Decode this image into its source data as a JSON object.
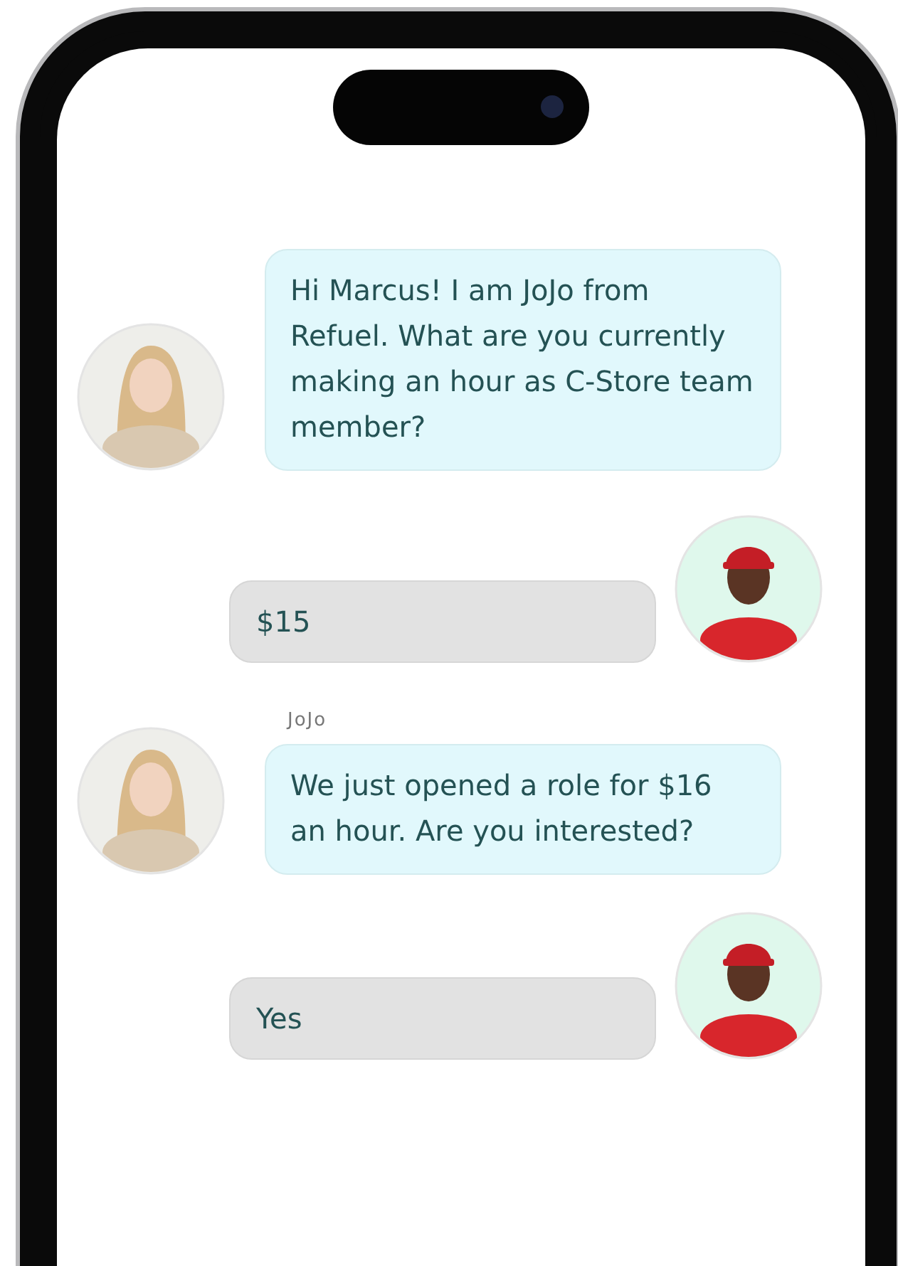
{
  "messages": [
    {
      "kind": "incoming",
      "text": "Hi Marcus! I am JoJo from Refuel. What are you currently making an hour as C-Store team member?"
    },
    {
      "kind": "outgoing",
      "text": "$15"
    },
    {
      "kind": "incoming",
      "sender": "JoJo",
      "text": "We just opened a role for $16 an hour. Are you interested?"
    },
    {
      "kind": "outgoing",
      "text": "Yes"
    }
  ]
}
